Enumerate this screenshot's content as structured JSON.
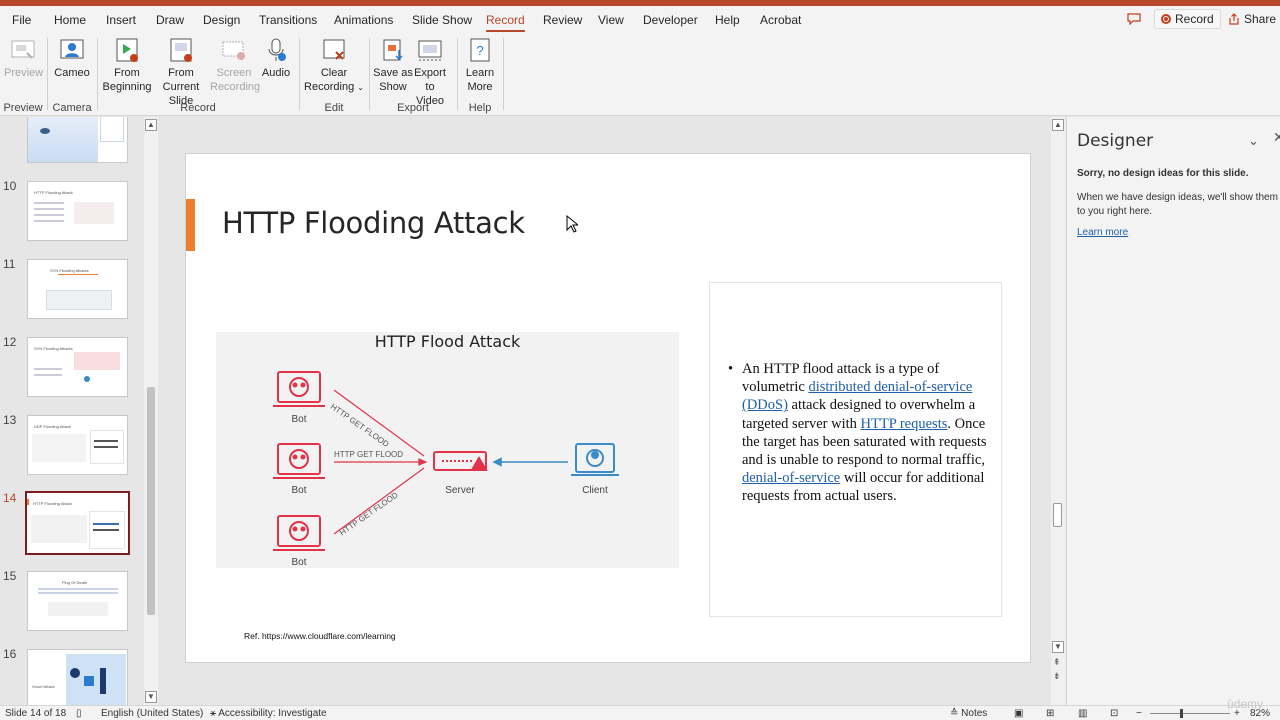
{
  "menu": {
    "tabs": [
      "File",
      "Home",
      "Insert",
      "Draw",
      "Design",
      "Transitions",
      "Animations",
      "Slide Show",
      "Record",
      "Review",
      "View",
      "Developer",
      "Help",
      "Acrobat"
    ],
    "active_tab": "Record",
    "record_label": "Record",
    "share_label": "Share"
  },
  "ribbon": {
    "preview": "Preview",
    "cameo": "Cameo",
    "from_beginning_1": "From",
    "from_beginning_2": "Beginning",
    "from_current_1": "From",
    "from_current_2": "Current Slide",
    "screen_rec_1": "Screen",
    "screen_rec_2": "Recording",
    "audio": "Audio",
    "clear_rec_1": "Clear",
    "clear_rec_2": "Recording",
    "save_show_1": "Save as",
    "save_show_2": "Show",
    "export_video_1": "Export",
    "export_video_2": "to Video",
    "learn_more_1": "Learn",
    "learn_more_2": "More",
    "groups": {
      "preview": "Preview",
      "camera": "Camera",
      "record": "Record",
      "edit": "Edit",
      "export": "Export",
      "help": "Help"
    }
  },
  "thumbnails": {
    "numbers": [
      "10",
      "11",
      "12",
      "13",
      "14",
      "15",
      "16"
    ],
    "active": "14",
    "titles": [
      "HTTP Flooding Attack",
      "SYN Flooding Attacks",
      "SYN Flooding Attacks",
      "UDP Flooding Attack",
      "HTTP Flooding Attack",
      "Ping Of Death",
      "Smurf Attack"
    ]
  },
  "slide": {
    "title": "HTTP Flooding Attack",
    "diagram": {
      "title": "HTTP Flood Attack",
      "bot_label": "Bot",
      "server_label": "Server",
      "client_label": "Client",
      "flood_label": "HTTP GET FLOOD"
    },
    "bullet": {
      "t1": "An HTTP flood attack is a type of volumetric ",
      "l1": "distributed denial-of-service (DDoS)",
      "t2": " attack designed to overwhelm a targeted server with ",
      "l2": "HTTP requests",
      "t3": ". Once the target has been saturated with requests and is unable to respond to normal traffic, ",
      "l3": "denial-of-service",
      "t4": " will occur for additional requests from actual users."
    },
    "ref": "Ref.  https://www.cloudflare.com/learning"
  },
  "designer": {
    "title": "Designer",
    "sorry": "Sorry, no design ideas for this slide.",
    "message": "When we have design ideas, we'll show them to you right here.",
    "learn_more": "Learn more"
  },
  "status": {
    "slide_of": "Slide 14 of 18",
    "language": "English (United States)",
    "accessibility": "Accessibility: Investigate",
    "notes": "Notes",
    "zoom": "82%"
  },
  "colors": {
    "accent": "#b7472a",
    "title_bar": "#ed7d31",
    "diagram_red": "#e2334b",
    "client_blue": "#3a8cc7",
    "link": "#1f5fa8"
  },
  "watermark": "ûdemy"
}
